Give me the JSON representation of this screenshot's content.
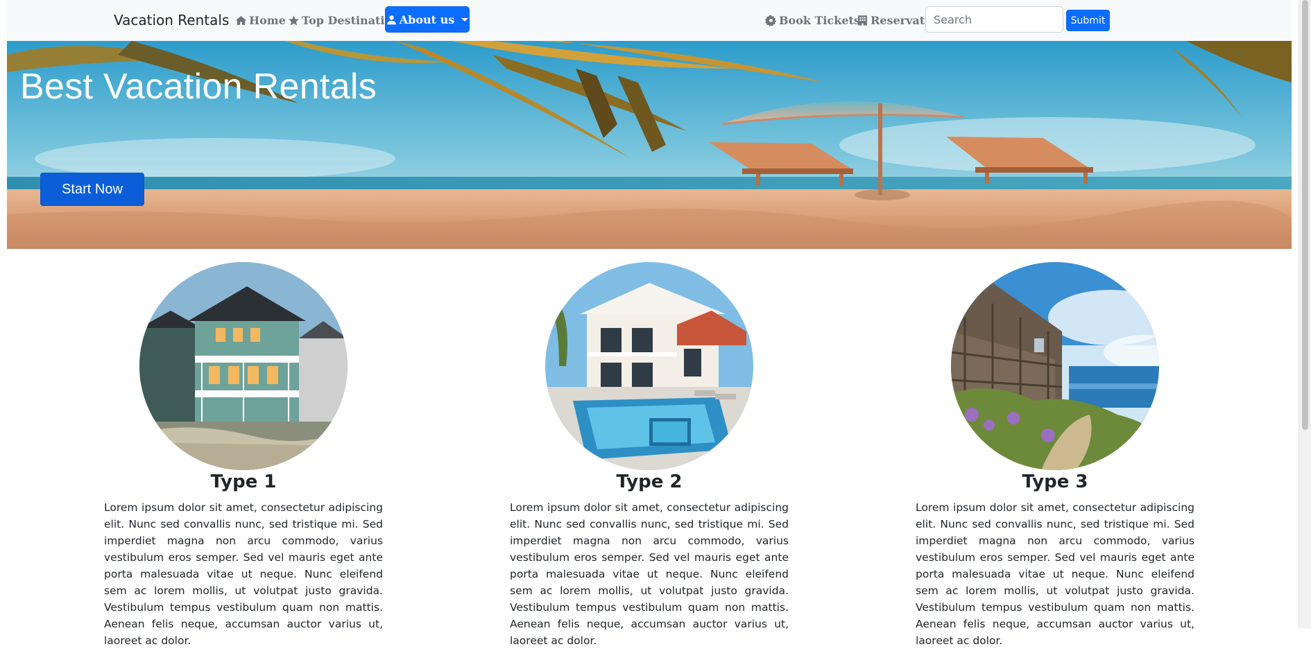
{
  "navbar": {
    "brand": "Vacation Rentals",
    "home": "Home",
    "top_destinations": "Top Destinations",
    "about": "About us",
    "book_tickets": "Book Tickets",
    "reservation": "Reservation",
    "search_placeholder": "Search",
    "submit": "Submit"
  },
  "hero": {
    "title": "Best Vacation Rentals",
    "cta": "Start Now"
  },
  "cards": [
    {
      "title": "Type 1",
      "text": "Lorem ipsum dolor sit amet, consectetur adipiscing elit. Nunc sed convallis nunc, sed tristique mi. Sed imperdiet magna non arcu commodo, varius vestibulum eros semper. Sed vel mauris eget ante porta malesuada vitae ut neque. Nunc eleifend sem ac lorem mollis, ut volutpat justo gravida. Vestibulum tempus vestibulum quam non mattis. Aenean felis neque, accumsan auctor varius ut, laoreet ac dolor."
    },
    {
      "title": "Type 2",
      "text": "Lorem ipsum dolor sit amet, consectetur adipiscing elit. Nunc sed convallis nunc, sed tristique mi. Sed imperdiet magna non arcu commodo, varius vestibulum eros semper. Sed vel mauris eget ante porta malesuada vitae ut neque. Nunc eleifend sem ac lorem mollis, ut volutpat justo gravida. Vestibulum tempus vestibulum quam non mattis. Aenean felis neque, accumsan auctor varius ut, laoreet ac dolor."
    },
    {
      "title": "Type 3",
      "text": "Lorem ipsum dolor sit amet, consectetur adipiscing elit. Nunc sed convallis nunc, sed tristique mi. Sed imperdiet magna non arcu commodo, varius vestibulum eros semper. Sed vel mauris eget ante porta malesuada vitae ut neque. Nunc eleifend sem ac lorem mollis, ut volutpat justo gravida. Vestibulum tempus vestibulum quam non mattis. Aenean felis neque, accumsan auctor varius ut, laoreet ac dolor."
    }
  ],
  "colors": {
    "primary": "#0d6efd",
    "navbar_bg": "#f8f9fa",
    "nav_link": "#6c757d"
  },
  "icons": {
    "home": "home-icon",
    "top_destinations": "star-icon",
    "about": "user-icon",
    "book_tickets": "gear-icon",
    "reservation": "building-icon"
  }
}
